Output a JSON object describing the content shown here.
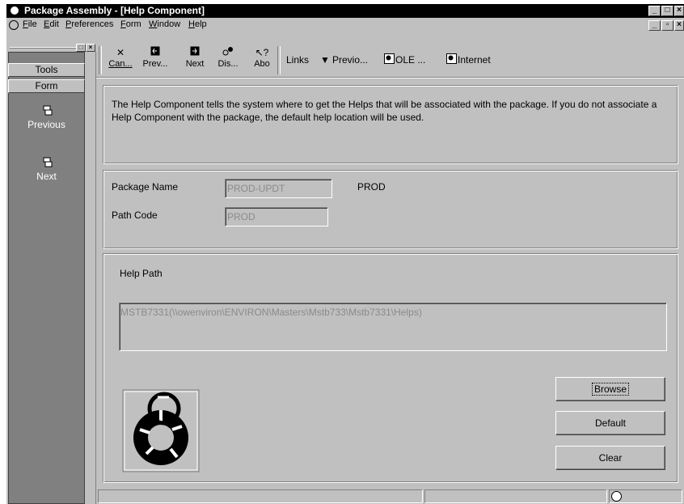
{
  "window": {
    "title": "Package Assembly - [Help Component]"
  },
  "menubar": {
    "items": [
      "File",
      "Edit",
      "Preferences",
      "Form",
      "Window",
      "Help"
    ]
  },
  "sidebar": {
    "tools_label": "Tools",
    "form_label": "Form",
    "items": [
      {
        "label": "Previous",
        "icon": "previous-form-icon"
      },
      {
        "label": "Next",
        "icon": "next-form-icon"
      }
    ]
  },
  "toolbar": {
    "buttons": [
      {
        "label": "Can...",
        "icon": "cancel-icon"
      },
      {
        "label": "Prev...",
        "icon": "previous-icon"
      },
      {
        "label": "Next",
        "icon": "next-icon"
      },
      {
        "label": "Dis...",
        "icon": "display-icon"
      },
      {
        "label": "Abo",
        "icon": "about-icon"
      }
    ],
    "links": [
      {
        "label": "Links",
        "icon": "dropdown-arrow-icon"
      },
      {
        "label": "Previo..."
      },
      {
        "label": "OLE ...",
        "icon": "ole-icon"
      },
      {
        "label": "Internet",
        "icon": "internet-icon"
      }
    ]
  },
  "main": {
    "description": "The Help Component  tells the system where to get the Helps that will be associated with the package.  If you do not associate a Help Component with the package, the default help location will be used.",
    "package_name_label": "Package Name",
    "package_name_value": "PROD-UPDT",
    "package_name_desc": "PROD",
    "path_code_label": "Path Code",
    "path_code_value": "PROD",
    "help_path_label": "Help Path",
    "help_path_value": "MSTB7331(\\\\owenviron\\ENVIRON\\Masters\\Mstb733\\Mstb7331\\Helps)",
    "buttons": {
      "browse": "Browse",
      "default": "Default",
      "clear": "Clear"
    }
  },
  "colors": {
    "sidebar_bg": "#808080",
    "chrome": "#c0c0c0",
    "titlebar": "#000000"
  }
}
